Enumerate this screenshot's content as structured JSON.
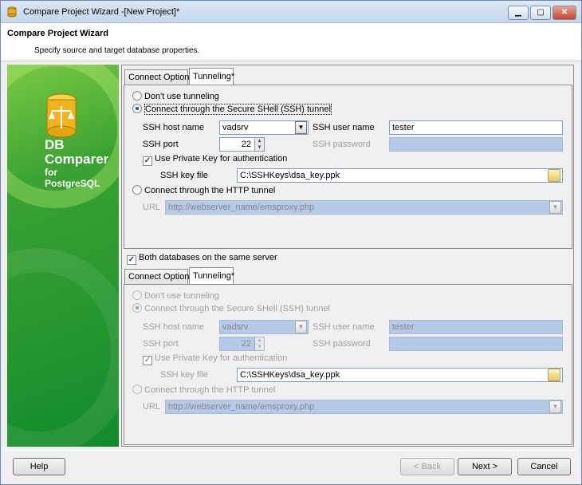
{
  "window": {
    "title": "Compare Project Wizard -[New Project]*"
  },
  "header": {
    "title": "Compare Project Wizard",
    "subtitle": "Specify source and target database properties."
  },
  "sidebar": {
    "brand_line1": "DB",
    "brand_line2": "Comparer",
    "brand_line3": "for",
    "brand_line4": "PostgreSQL"
  },
  "source": {
    "tabs": [
      "Connect Options",
      "Tunneling*"
    ],
    "no_tunnel": "Don't use tunneling",
    "ssh_tunnel": "Connect through the Secure SHell (SSH) tunnel",
    "ssh_host_label": "SSH host name",
    "ssh_host_value": "vadsrv",
    "ssh_user_label": "SSH user name",
    "ssh_user_value": "tester",
    "ssh_port_label": "SSH port",
    "ssh_port_value": "22",
    "ssh_password_label": "SSH password",
    "ssh_password_value": "",
    "use_key_label": "Use Private Key for authentication",
    "key_file_label": "SSH key file",
    "key_file_value": "C:\\SSHKeys\\dsa_key.ppk",
    "http_tunnel": "Connect through the HTTP tunnel",
    "url_label": "URL",
    "url_value": "http://webserver_name/emsproxy.php"
  },
  "same_server": {
    "label": "Both databases on the same server"
  },
  "target": {
    "tabs": [
      "Connect Options",
      "Tunneling*"
    ],
    "no_tunnel": "Don't use tunneling",
    "ssh_tunnel": "Connect through the Secure SHell (SSH) tunnel",
    "ssh_host_label": "SSH host name",
    "ssh_host_value": "vadsrv",
    "ssh_user_label": "SSH user name",
    "ssh_user_value": "tester",
    "ssh_port_label": "SSH port",
    "ssh_port_value": "22",
    "ssh_password_label": "SSH password",
    "ssh_password_value": "",
    "use_key_label": "Use Private Key for authentication",
    "key_file_label": "SSH key file",
    "key_file_value": "C:\\SSHKeys\\dsa_key.ppk",
    "http_tunnel": "Connect through the HTTP tunnel",
    "url_label": "URL",
    "url_value": "http://webserver_name/emsproxy.php"
  },
  "buttons": {
    "help": "Help",
    "back": "< Back",
    "next": "Next >",
    "cancel": "Cancel"
  },
  "colors": {
    "accent_green": "#2f9a34",
    "disabled_field": "#b5c9e8"
  }
}
